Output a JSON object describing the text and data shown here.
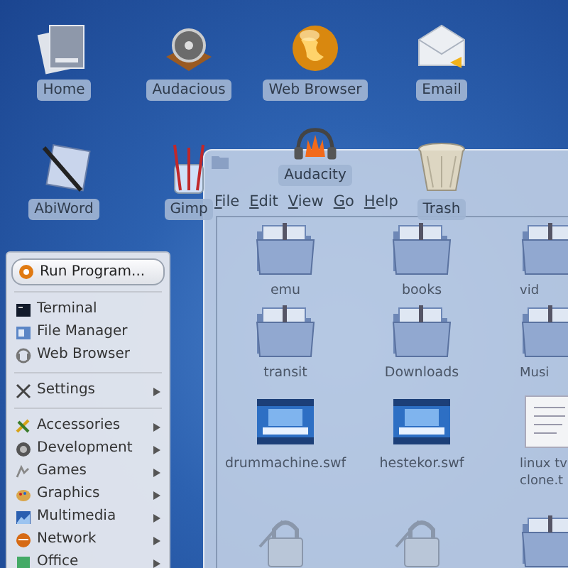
{
  "desktop_icons": [
    {
      "label": "Home"
    },
    {
      "label": "Audacious"
    },
    {
      "label": "Web Browser"
    },
    {
      "label": "Email"
    },
    {
      "label": "AbiWord"
    },
    {
      "label": "Gimp"
    },
    {
      "label": "Audacity"
    },
    {
      "label": "Trash"
    }
  ],
  "file_manager": {
    "menu": [
      "File",
      "Edit",
      "View",
      "Go",
      "Help"
    ],
    "files": [
      {
        "kind": "folder",
        "label": "emu"
      },
      {
        "kind": "folder",
        "label": "books"
      },
      {
        "kind": "folder",
        "label": "vid"
      },
      {
        "kind": "folder",
        "label": "transit"
      },
      {
        "kind": "folder",
        "label": "Downloads"
      },
      {
        "kind": "folder",
        "label": "Musi"
      },
      {
        "kind": "media",
        "label": "drummachine.swf"
      },
      {
        "kind": "media",
        "label": "hestekor.swf"
      },
      {
        "kind": "document",
        "label": "linux tv clone.t"
      },
      {
        "kind": "lock"
      },
      {
        "kind": "lock"
      },
      {
        "kind": "folder"
      }
    ]
  },
  "start_menu": {
    "items": [
      {
        "kind": "button",
        "label": "Run Program..."
      },
      {
        "kind": "separator"
      },
      {
        "kind": "item",
        "label": "Terminal",
        "submenu": false
      },
      {
        "kind": "item",
        "label": "File Manager",
        "submenu": false
      },
      {
        "kind": "item",
        "label": "Web Browser",
        "submenu": false
      },
      {
        "kind": "separator"
      },
      {
        "kind": "item",
        "label": "Settings",
        "submenu": true
      },
      {
        "kind": "separator"
      },
      {
        "kind": "item",
        "label": "Accessories",
        "submenu": true
      },
      {
        "kind": "item",
        "label": "Development",
        "submenu": true
      },
      {
        "kind": "item",
        "label": "Games",
        "submenu": true
      },
      {
        "kind": "item",
        "label": "Graphics",
        "submenu": true
      },
      {
        "kind": "item",
        "label": "Multimedia",
        "submenu": true
      },
      {
        "kind": "item",
        "label": "Network",
        "submenu": true
      },
      {
        "kind": "item",
        "label": "Office",
        "submenu": true
      }
    ]
  }
}
